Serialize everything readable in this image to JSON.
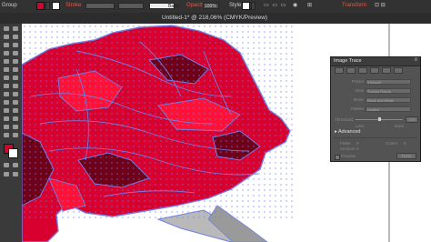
{
  "control_bar": {
    "selection_label": "Group",
    "stroke_label": "Stroke",
    "brush_label": "Basic",
    "opacity_label": "Opacity",
    "opacity_value": "100%",
    "style_label": "Style",
    "transform_label": "Transform"
  },
  "document": {
    "tab_title": "Untitled-1* @ 218,06% (CMYK/Preview)"
  },
  "image_trace": {
    "title": "Image Trace",
    "preset_label": "Preset",
    "preset_value": "[Default]",
    "view_label": "View",
    "view_value": "Tracing Result",
    "mode_label": "Mode",
    "mode_value": "Black and White",
    "palette_label": "Palette",
    "palette_value": "Limited",
    "threshold_label": "Threshold",
    "threshold_value": "128",
    "less_label": "Less",
    "more_label": "More",
    "advanced_label": "Advanced",
    "paths_label": "Paths",
    "paths_value": "0",
    "colors_label": "Colors",
    "colors_value": "0",
    "anchors_label": "Anchors",
    "anchors_value": "0",
    "preview_label": "Preview",
    "trace_button": "Trace"
  },
  "colors": {
    "rose_red": "#d8002e",
    "rose_dark": "#6e001a",
    "path_blue": "#6f7fe6",
    "stroke_accent": "#e05a4a"
  }
}
